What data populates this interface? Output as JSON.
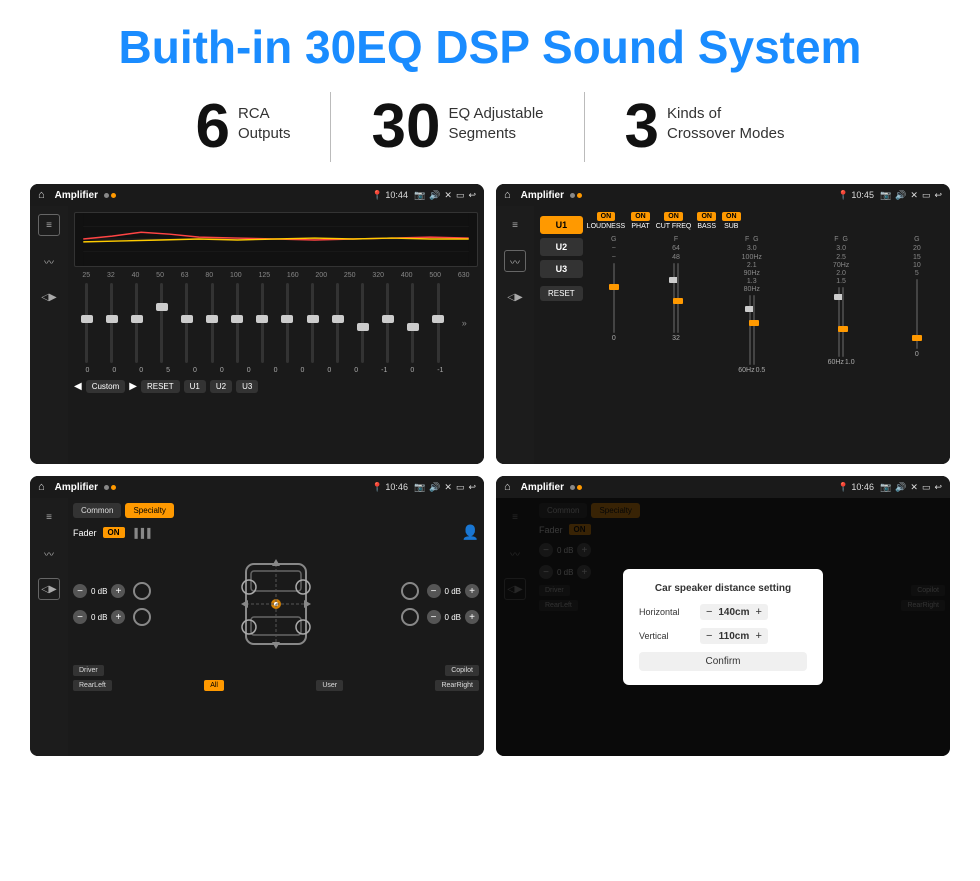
{
  "header": {
    "title": "Buith-in 30EQ DSP Sound System"
  },
  "stats": [
    {
      "number": "6",
      "line1": "RCA",
      "line2": "Outputs"
    },
    {
      "number": "30",
      "line1": "EQ Adjustable",
      "line2": "Segments"
    },
    {
      "number": "3",
      "line1": "Kinds of",
      "line2": "Crossover Modes"
    }
  ],
  "screens": [
    {
      "id": "screen-eq",
      "topbar": {
        "title": "Amplifier",
        "time": "10:44"
      },
      "type": "eq"
    },
    {
      "id": "screen-amp",
      "topbar": {
        "title": "Amplifier",
        "time": "10:45"
      },
      "type": "amp"
    },
    {
      "id": "screen-crossover",
      "topbar": {
        "title": "Amplifier",
        "time": "10:46"
      },
      "type": "crossover"
    },
    {
      "id": "screen-dialog",
      "topbar": {
        "title": "Amplifier",
        "time": "10:46"
      },
      "type": "dialog",
      "dialog": {
        "title": "Car speaker distance setting",
        "horizontal_label": "Horizontal",
        "horizontal_value": "140cm",
        "vertical_label": "Vertical",
        "vertical_value": "110cm",
        "confirm_label": "Confirm"
      }
    }
  ],
  "eq": {
    "freqs": [
      "25",
      "32",
      "40",
      "50",
      "63",
      "80",
      "100",
      "125",
      "160",
      "200",
      "250",
      "320",
      "400",
      "500",
      "630"
    ],
    "values": [
      "0",
      "0",
      "0",
      "5",
      "0",
      "0",
      "0",
      "0",
      "0",
      "0",
      "0",
      "-1",
      "0",
      "-1"
    ],
    "preset": "Custom",
    "buttons": [
      "RESET",
      "U1",
      "U2",
      "U3"
    ]
  },
  "amp": {
    "u_buttons": [
      "U1",
      "U2",
      "U3"
    ],
    "controls": [
      "LOUDNESS",
      "PHAT",
      "CUT FREQ",
      "BASS",
      "SUB"
    ]
  },
  "crossover": {
    "tabs": [
      "Common",
      "Specialty"
    ],
    "active_tab": "Specialty",
    "fader_label": "Fader",
    "fader_on": "ON",
    "bottom_buttons": [
      "Driver",
      "RearLeft",
      "All",
      "User",
      "Copilot",
      "RearRight"
    ]
  },
  "dialog": {
    "title": "Car speaker distance setting",
    "horizontal_label": "Horizontal",
    "horizontal_value": "140cm",
    "vertical_label": "Vertical",
    "vertical_value": "110cm",
    "confirm_label": "Confirm"
  }
}
